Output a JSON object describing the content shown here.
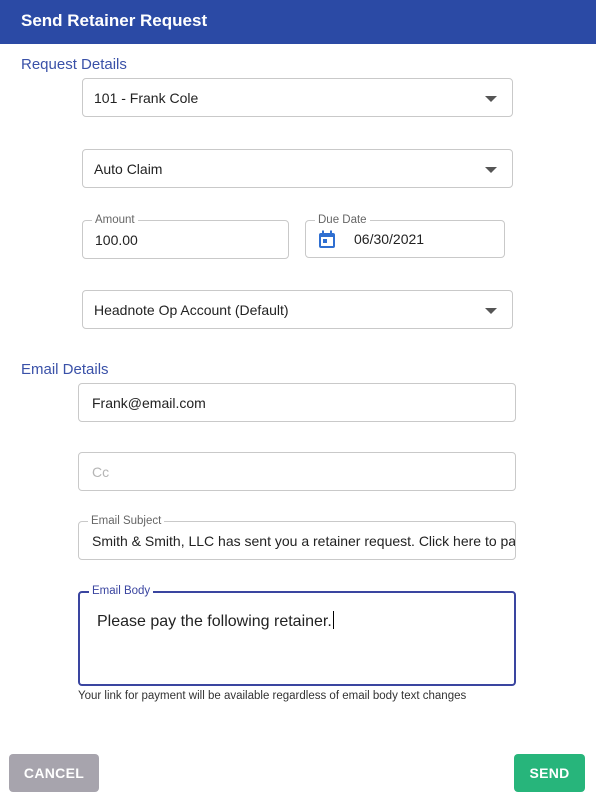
{
  "dialog": {
    "title": "Send Retainer Request"
  },
  "sections": {
    "request_details": "Request Details",
    "email_details": "Email Details"
  },
  "request": {
    "client": "101 - Frank Cole",
    "matter": "Auto Claim",
    "amount_label": "Amount",
    "amount": "100.00",
    "due_date_label": "Due Date",
    "due_date": "06/30/2021",
    "account": "Headnote Op Account (Default)"
  },
  "email": {
    "to": "Frank@email.com",
    "cc_placeholder": "Cc",
    "subject_label": "Email Subject",
    "subject": "Smith & Smith, LLC has sent you a retainer request. Click here to pay",
    "body_label": "Email Body",
    "body": "Please pay the following retainer.",
    "helper": "Your link for payment will be available regardless of email body text changes"
  },
  "buttons": {
    "cancel": "CANCEL",
    "send": "SEND"
  },
  "colors": {
    "header_bg": "#2b4aa5",
    "section_title": "#3a51a8",
    "focus_border": "#3a45a0",
    "cancel_bg": "#a7a4ad",
    "send_bg": "#27b57b"
  },
  "icons": {
    "dropdown": "chevron-down-icon",
    "date": "calendar-icon"
  }
}
